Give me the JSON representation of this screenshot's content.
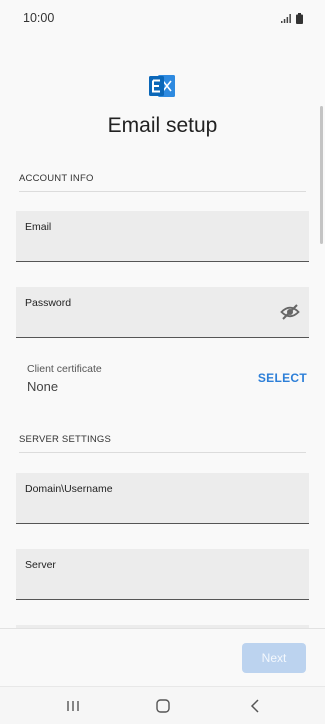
{
  "status_bar": {
    "time": "10:00"
  },
  "screen": {
    "title": "Email setup"
  },
  "account_info": {
    "header": "ACCOUNT INFO",
    "email_label": "Email",
    "email_value": "",
    "password_label": "Password",
    "password_value": "",
    "certificate": {
      "label": "Client certificate",
      "value": "None",
      "select_label": "SELECT"
    }
  },
  "server_settings": {
    "header": "SERVER SETTINGS",
    "domain_label": "Domain\\Username",
    "domain_value": "",
    "server_label": "Server",
    "server_value": ""
  },
  "footer": {
    "next_label": "Next"
  },
  "colors": {
    "accent": "#2d7fd8",
    "next_disabled": "#bcd3ef",
    "exchange_logo": "#0b67b8"
  },
  "icons": [
    "signal-icon",
    "battery-icon",
    "exchange-logo-icon",
    "eye-off-icon",
    "recents-icon",
    "home-icon",
    "back-icon"
  ]
}
